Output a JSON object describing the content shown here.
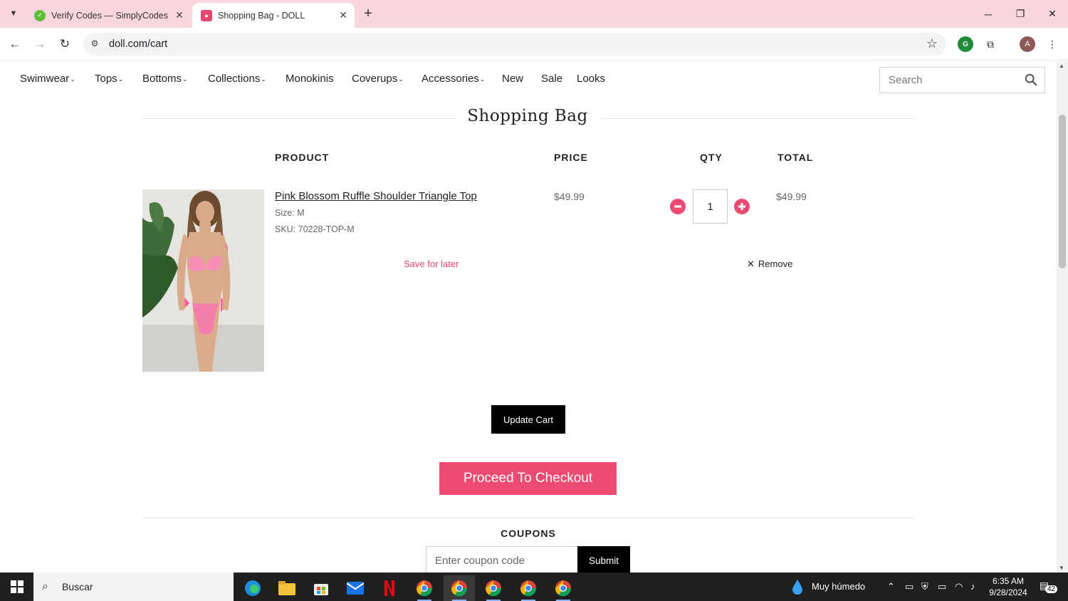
{
  "browser": {
    "tabs": [
      {
        "label": "Verify Codes — SimplyCodes",
        "active": false,
        "favicon": "simplycodes-icon"
      },
      {
        "label": "Shopping Bag - DOLL",
        "active": true,
        "favicon": "doll-icon"
      }
    ],
    "url": "doll.com/cart",
    "profile_initial": "A"
  },
  "nav": {
    "items": [
      {
        "label": "Swimwear",
        "has_caret": true
      },
      {
        "label": "Tops",
        "has_caret": true
      },
      {
        "label": "Bottoms",
        "has_caret": true
      },
      {
        "label": "Collections",
        "has_caret": true
      },
      {
        "label": "Monokinis",
        "has_caret": false
      },
      {
        "label": "Coverups",
        "has_caret": true
      },
      {
        "label": "Accessories",
        "has_caret": true
      },
      {
        "label": "New",
        "has_caret": false
      },
      {
        "label": "Sale",
        "has_caret": false
      },
      {
        "label": "Looks",
        "has_caret": false
      }
    ],
    "search_placeholder": "Search"
  },
  "cart": {
    "title": "Shopping Bag",
    "columns": {
      "product": "PRODUCT",
      "price": "PRICE",
      "qty": "QTY",
      "total": "TOTAL"
    },
    "item": {
      "name": "Pink Blossom Ruffle Shoulder Triangle Top",
      "size": "Size: M",
      "sku": "SKU: 70228-TOP-M",
      "price": "$49.99",
      "qty": "1",
      "total": "$49.99",
      "save_for_later": "Save for later",
      "remove": "Remove"
    },
    "update_label": "Update Cart",
    "checkout_label": "Proceed To Checkout",
    "coupons_title": "COUPONS",
    "coupon_placeholder": "Enter coupon code",
    "submit_label": "Submit"
  },
  "taskbar": {
    "search_label": "Buscar",
    "weather": "Muy húmedo",
    "time": "6:35 AM",
    "date": "9/28/2024",
    "notifications": "42"
  },
  "colors": {
    "brand_pink": "#ee4b73",
    "tabbar": "#f9d6de"
  }
}
